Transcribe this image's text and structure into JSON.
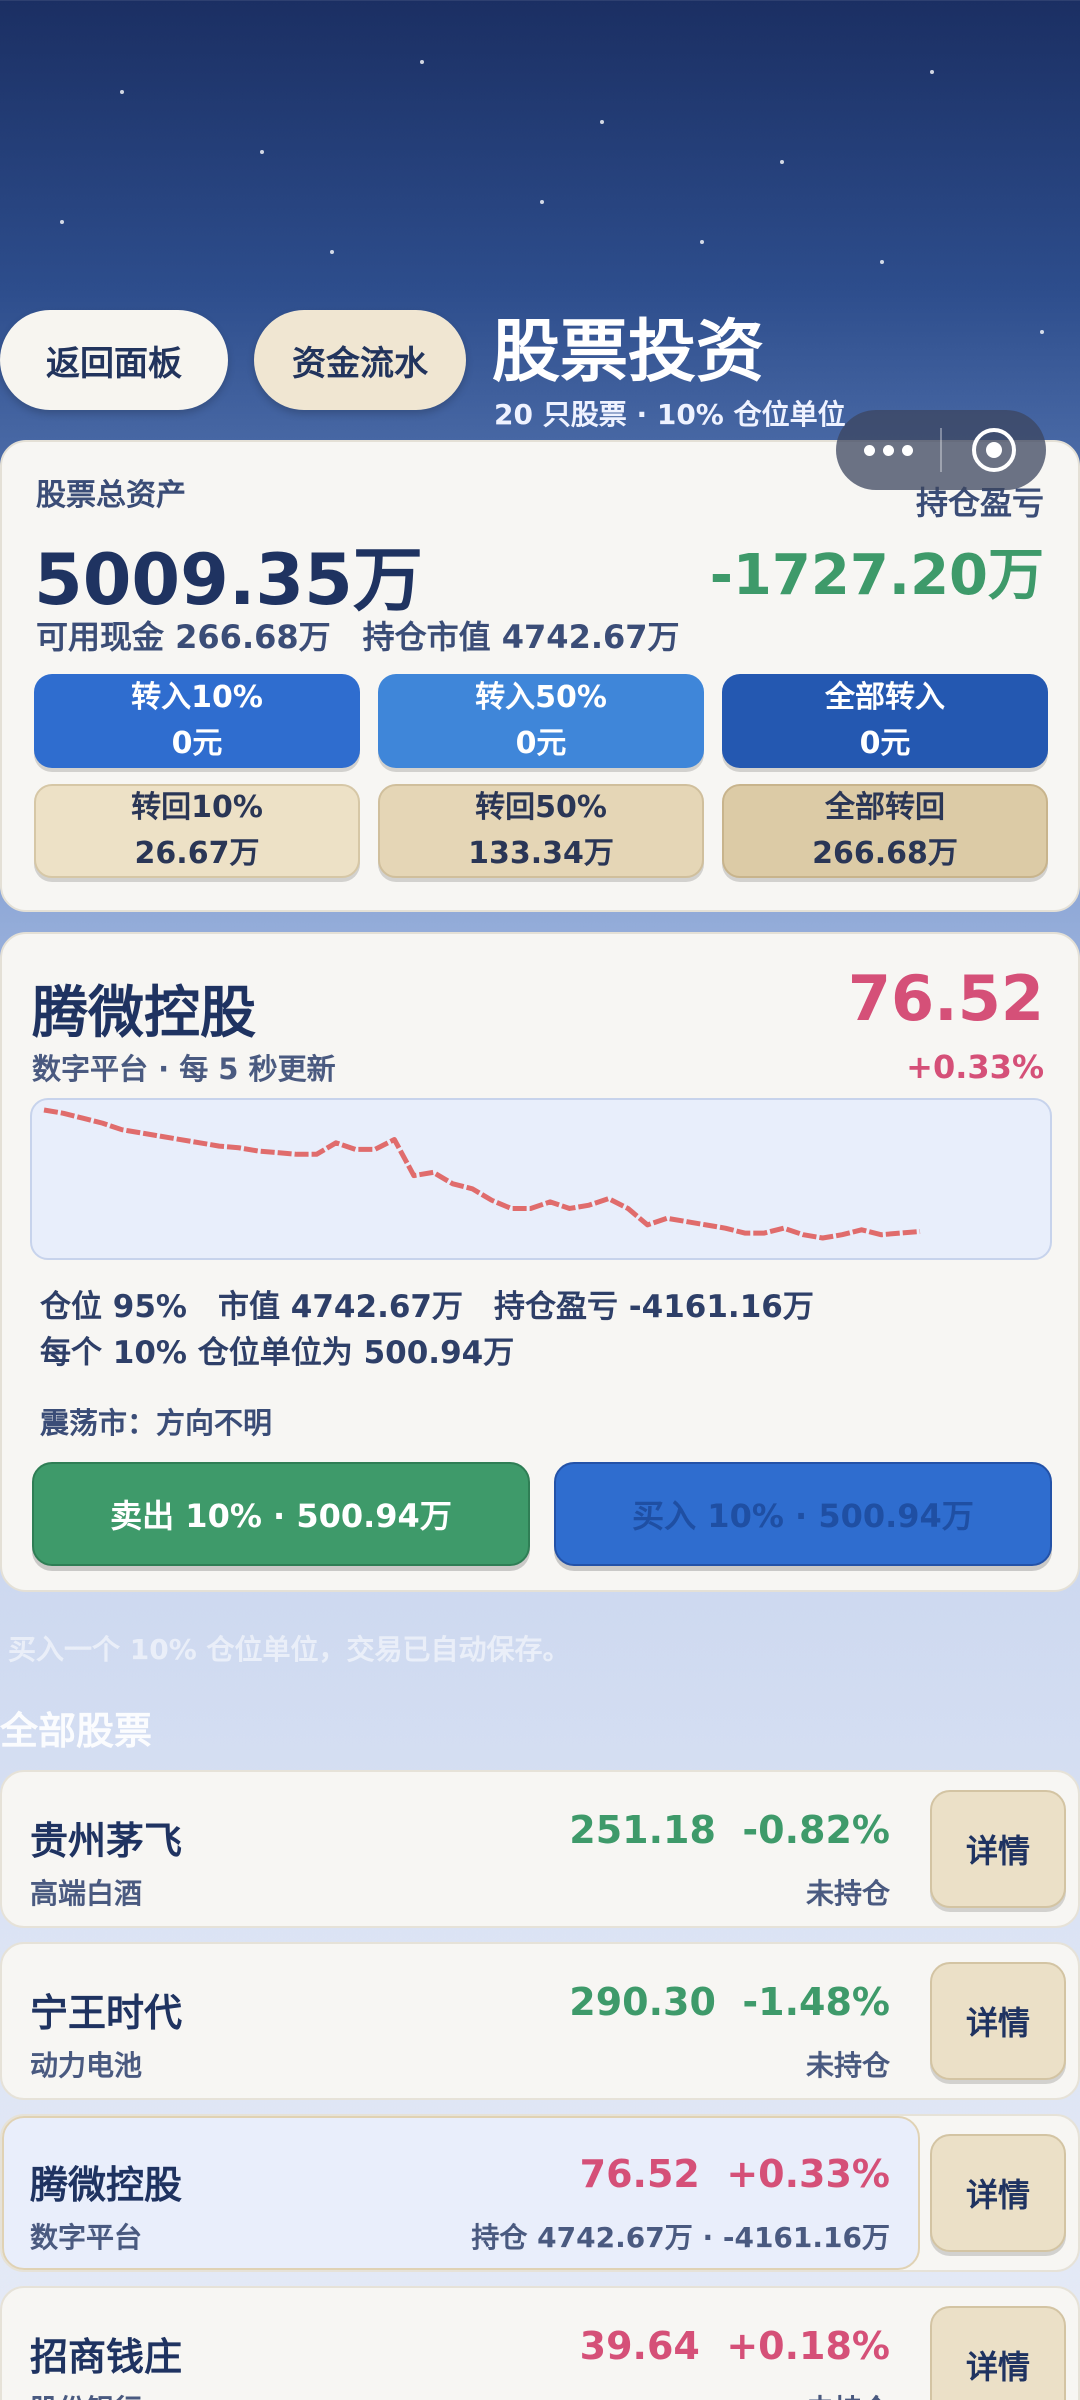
{
  "header": {
    "back_label": "返回面板",
    "flow_label": "资金流水",
    "title": "股票投资",
    "subtitle": "20 只股票 · 10% 仓位单位"
  },
  "assets": {
    "label": "股票总资产",
    "value": "5009.35万",
    "pnl_label": "持仓盈亏",
    "pnl_value": "-1727.20万",
    "summary": "可用现金 266.68万　持仓市值 4742.67万",
    "transfer_in": [
      {
        "label": "转入10%",
        "amount": "0元"
      },
      {
        "label": "转入50%",
        "amount": "0元"
      },
      {
        "label": "全部转入",
        "amount": "0元"
      }
    ],
    "transfer_out": [
      {
        "label": "转回10%",
        "amount": "26.67万"
      },
      {
        "label": "转回50%",
        "amount": "133.34万"
      },
      {
        "label": "全部转回",
        "amount": "266.68万"
      }
    ]
  },
  "stock": {
    "name": "腾微控股",
    "price": "76.52",
    "meta": "数字平台 · 每 5 秒更新",
    "change": "+0.33%",
    "info_line1": "仓位 95%　市值 4742.67万　持仓盈亏 -4161.16万",
    "info_line2": "每个 10% 仓位单位为 500.94万",
    "market_note": "震荡市：方向不明",
    "sell_label": "卖出 10% · 500.94万",
    "buy_label": "买入 10% · 500.94万",
    "colors": {
      "up": "#d55078",
      "down": "#3e9a6a",
      "line": "#e06c6c"
    }
  },
  "chart_data": {
    "type": "line",
    "x": [
      0,
      1,
      2,
      3,
      4,
      5,
      6,
      7,
      8,
      9,
      10,
      11,
      12,
      13,
      14,
      15,
      16,
      17,
      18,
      19,
      20,
      21,
      22,
      23,
      24,
      25,
      26,
      27,
      28,
      29,
      30,
      31,
      32,
      33,
      34,
      35,
      36,
      37,
      38,
      39,
      40,
      41,
      42,
      43,
      44,
      45,
      46,
      47,
      48,
      49,
      50,
      51,
      52
    ],
    "values": [
      77.0,
      76.98,
      76.95,
      76.92,
      76.88,
      76.86,
      76.84,
      76.82,
      76.8,
      76.78,
      76.77,
      76.75,
      76.74,
      76.73,
      76.73,
      76.8,
      76.76,
      76.76,
      76.82,
      76.6,
      76.62,
      76.55,
      76.52,
      76.45,
      76.4,
      76.4,
      76.44,
      76.4,
      76.42,
      76.46,
      76.4,
      76.3,
      76.34,
      76.32,
      76.3,
      76.28,
      76.25,
      76.25,
      76.28,
      76.24,
      76.22,
      76.24,
      76.27,
      76.24,
      76.25,
      76.26
    ],
    "title": "",
    "xlabel": "",
    "ylabel": "",
    "grid": false
  },
  "section": {
    "info": "买入一个 10% 仓位单位，交易已自动保存。",
    "title": "全部股票"
  },
  "stock_list": [
    {
      "name": "贵州茅飞",
      "sub": "高端白酒",
      "price": "251.18",
      "change": "-0.82%",
      "hold": "未持仓",
      "trend": "down",
      "detail": "详情"
    },
    {
      "name": "宁王时代",
      "sub": "动力电池",
      "price": "290.30",
      "change": "-1.48%",
      "hold": "未持仓",
      "trend": "down",
      "detail": "详情"
    },
    {
      "name": "腾微控股",
      "sub": "数字平台",
      "price": "76.52",
      "change": "+0.33%",
      "hold": "持仓 4742.67万 · -4161.16万",
      "trend": "up",
      "detail": "详情"
    },
    {
      "name": "招商钱庄",
      "sub": "股份银行",
      "price": "39.64",
      "change": "+0.18%",
      "hold": "未持仓",
      "trend": "up",
      "detail": "详情"
    }
  ]
}
